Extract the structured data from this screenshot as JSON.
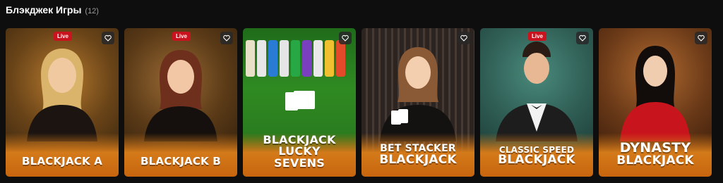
{
  "section": {
    "title": "Блэкджек Игры",
    "count": "(12)"
  },
  "cards": [
    {
      "name_lines": [
        "BLACKJACK A"
      ],
      "live": "Live",
      "bg": [
        "#6a4418",
        "#2b1c0c"
      ]
    },
    {
      "name_lines": [
        "BLACKJACK B"
      ],
      "live": "Live",
      "bg": [
        "#5a3a17",
        "#261709"
      ]
    },
    {
      "name_lines": [
        "BLACKJACK",
        "LUCKY",
        "SEVENS"
      ],
      "live": "",
      "bg": [
        "#2f8a22",
        "#144a10"
      ]
    },
    {
      "name_lines": [
        "BET STACKER",
        "BLACKJACK"
      ],
      "live": "",
      "bg": [
        "#3a2e28",
        "#17110d"
      ]
    },
    {
      "name_lines": [
        "CLASSIC SPEED",
        "BLACKJACK"
      ],
      "live": "Live",
      "bg": [
        "#2f5d54",
        "#14302b"
      ]
    },
    {
      "name_lines": [
        "DYNASTY",
        "BLACKJACK"
      ],
      "live": "",
      "bg": [
        "#6b3a18",
        "#2a1206"
      ]
    }
  ],
  "icons": {
    "favorite": "heart-icon"
  }
}
